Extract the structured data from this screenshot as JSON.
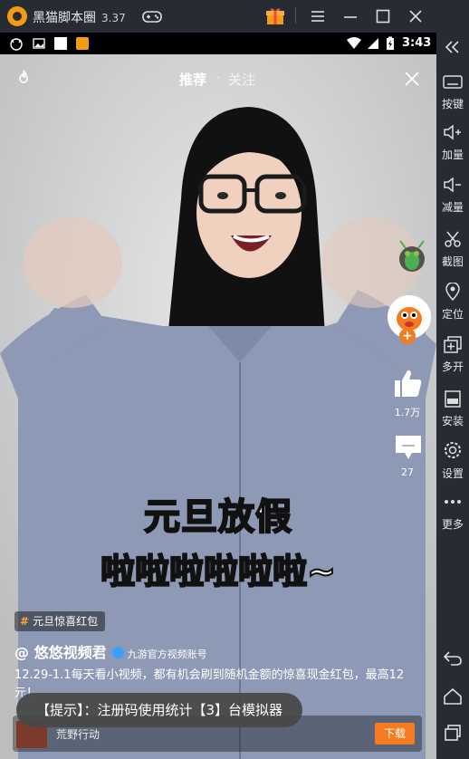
{
  "window": {
    "title": "黑猫脚本圈",
    "version": "3.37"
  },
  "status": {
    "time": "3:43"
  },
  "video_app": {
    "tabs": [
      {
        "label": "推荐"
      },
      {
        "label": "关注"
      }
    ],
    "tab_separator": "·",
    "caption_line1": "元旦放假",
    "caption_line2": "啦啦啦啦啦啦~",
    "likes": "1.7万",
    "comments": "27",
    "follow_plus": "+",
    "tag": "元旦惊喜红包",
    "tag_hash": "#",
    "author": "@ 悠悠视频君",
    "author_sub": "九游官方视频账号",
    "description": "12.29-1.1每天看小视频，都有机会刷到随机金额的惊喜现金红包，最高12元！",
    "ad_name": "荒野行动",
    "ad_button": "下载"
  },
  "toast": "【提示】：注册码使用统计【3】台模拟器",
  "sidebar": {
    "items": [
      {
        "label": "按键"
      },
      {
        "label": "加量"
      },
      {
        "label": "减量"
      },
      {
        "label": "截图"
      },
      {
        "label": "定位"
      },
      {
        "label": "多开"
      },
      {
        "label": "安装"
      },
      {
        "label": "设置"
      },
      {
        "label": "更多"
      }
    ]
  },
  "colors": {
    "accent": "#f47b20",
    "titlebar": "#272b33",
    "verified": "#3aa0ff"
  }
}
